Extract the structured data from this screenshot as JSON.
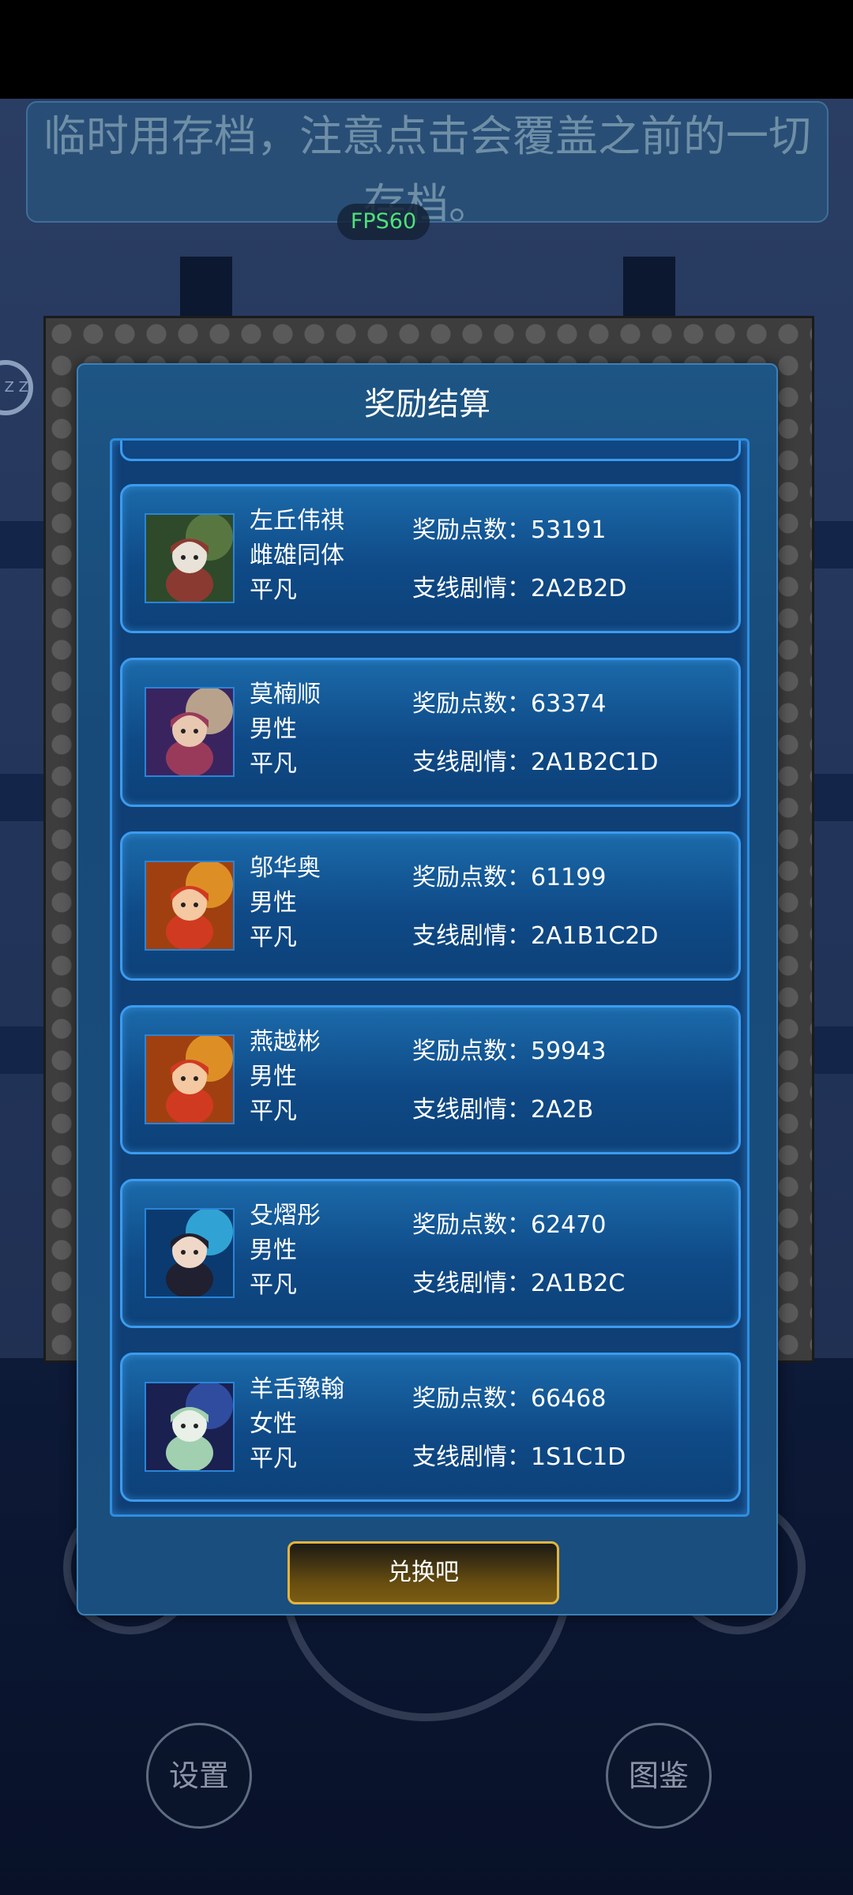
{
  "notice": {
    "text": "临时用存档，注意点击会覆盖之前的一切存档。"
  },
  "fps": "FPS60",
  "background": {
    "settings_label": "设置",
    "gallery_label": "图鉴",
    "side_circle_text": "Z Z"
  },
  "modal": {
    "title": "奖励结算",
    "redeem_label": "兑换吧",
    "points_label": "奖励点数：",
    "story_label": "支线剧情：",
    "cards": [
      {
        "name": "左丘伟祺",
        "gender": "雌雄同体",
        "rank": "平凡",
        "points": "53191",
        "story": "2A2B2D",
        "portrait": "forest-girl"
      },
      {
        "name": "莫楠顺",
        "gender": "男性",
        "rank": "平凡",
        "points": "63374",
        "story": "2A1B2C1D",
        "portrait": "moon-girl"
      },
      {
        "name": "邬华奥",
        "gender": "男性",
        "rank": "平凡",
        "points": "61199",
        "story": "2A1B1C2D",
        "portrait": "fire-girl"
      },
      {
        "name": "燕越彬",
        "gender": "男性",
        "rank": "平凡",
        "points": "59943",
        "story": "2A2B",
        "portrait": "fire-girl"
      },
      {
        "name": "殳熠彤",
        "gender": "男性",
        "rank": "平凡",
        "points": "62470",
        "story": "2A1B2C",
        "portrait": "ice-boy"
      },
      {
        "name": "羊舌豫翰",
        "gender": "女性",
        "rank": "平凡",
        "points": "66468",
        "story": "1S1C1D",
        "portrait": "star-girl"
      }
    ]
  },
  "colors": {
    "accent_border": "#3b9bef",
    "button_border": "#e3b43c",
    "fps_text": "#4fe07a"
  }
}
